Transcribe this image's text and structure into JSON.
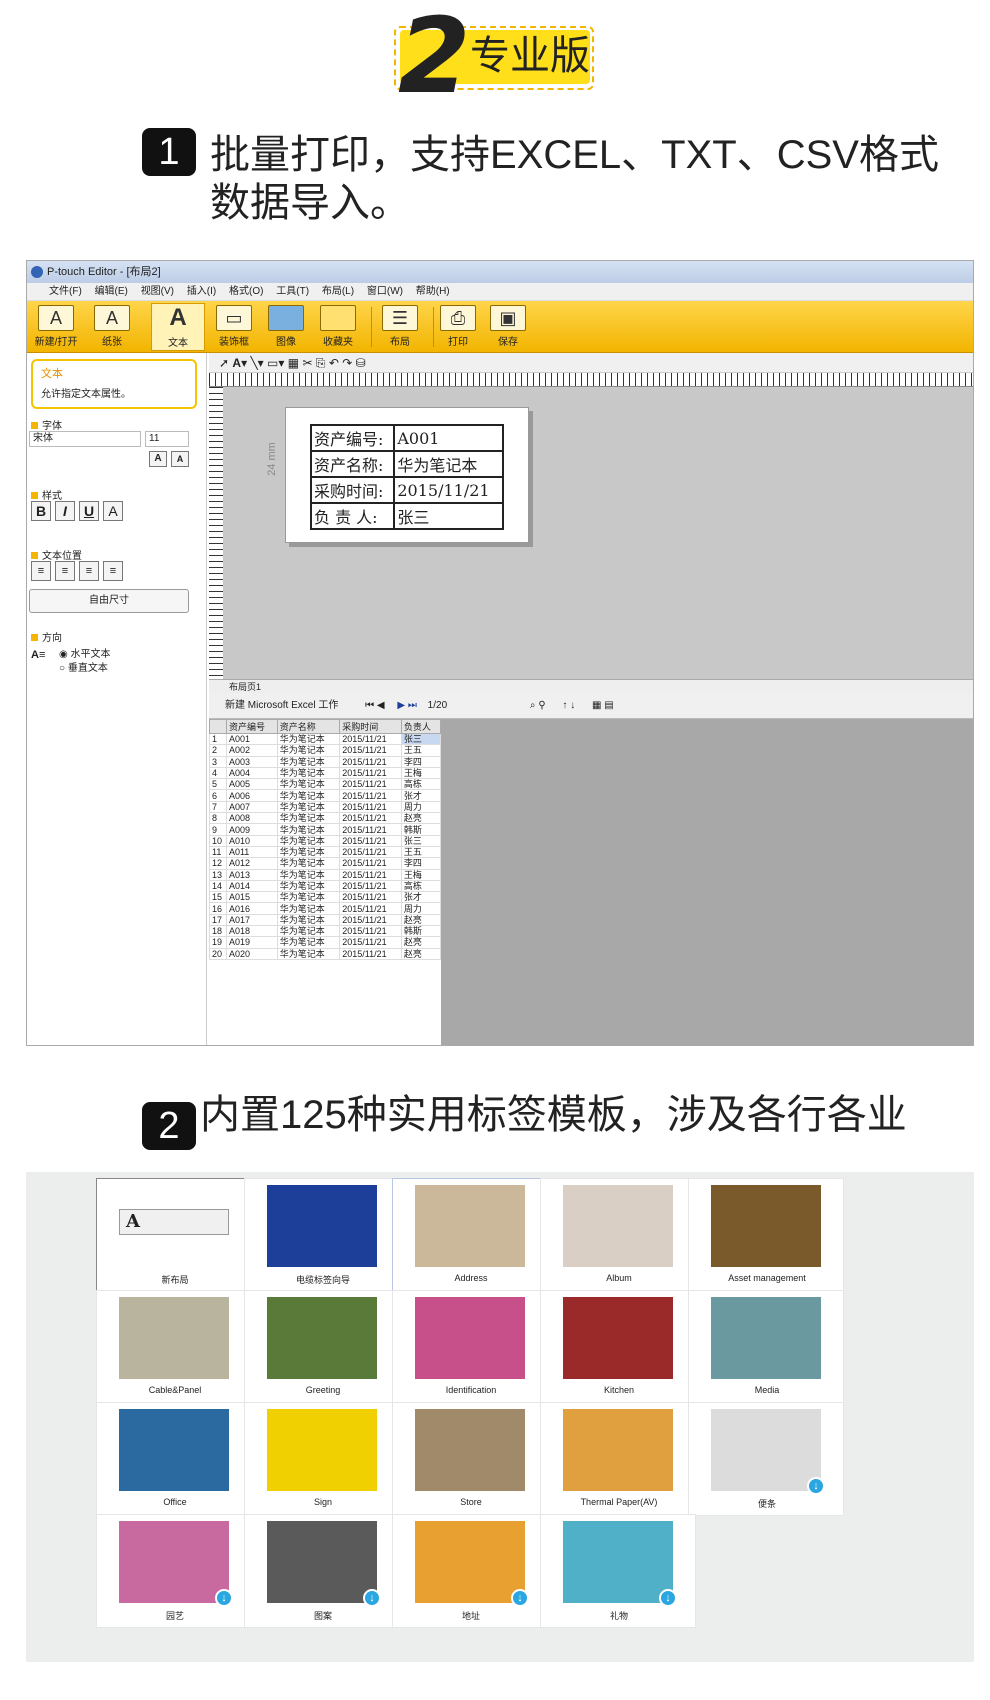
{
  "badge": {
    "number": "2",
    "text": "专业版"
  },
  "section1": {
    "number": "1",
    "line1": "批量打印，支持EXCEL、TXT、CSV格式",
    "line2": "数据导入。"
  },
  "section2": {
    "number": "2",
    "text": "内置125种实用标签模板，涉及各行各业"
  },
  "app": {
    "title": "P-touch Editor - [布局2]",
    "menu": [
      "文件(F)",
      "编辑(E)",
      "视图(V)",
      "插入(I)",
      "格式(O)",
      "工具(T)",
      "布局(L)",
      "窗口(W)",
      "帮助(H)"
    ],
    "ribbon": [
      "新建/打开",
      "纸张",
      "文本",
      "装饰框",
      "图像",
      "收藏夹",
      "布局",
      "打印",
      "保存"
    ],
    "panel": {
      "title": "文本",
      "desc": "允许指定文本属性。",
      "font_section": "字体",
      "font_name": "宋体",
      "font_size": "11",
      "style_section": "样式",
      "pos_section": "文本位置",
      "autosize": "自由尺寸",
      "dir_section": "方向",
      "dir_h": "水平文本",
      "dir_v": "垂直文本"
    },
    "canvas": {
      "mm": "24 mm",
      "tab": "布局页1",
      "label_rows": [
        [
          "资产编号:",
          "A001"
        ],
        [
          "资产名称:",
          "华为笔记本"
        ],
        [
          "采购时间:",
          "2015/11/21"
        ],
        [
          "负 责 人:",
          "张三"
        ]
      ]
    },
    "db": {
      "toolbar": "新建 Microsoft Excel 工作",
      "page": "1/20",
      "headers": [
        "",
        "资产编号",
        "资产名称",
        "采购时间",
        "负责人"
      ],
      "rows": [
        [
          "1",
          "A001",
          "华为笔记本",
          "2015/11/21",
          "张三"
        ],
        [
          "2",
          "A002",
          "华为笔记本",
          "2015/11/21",
          "王五"
        ],
        [
          "3",
          "A003",
          "华为笔记本",
          "2015/11/21",
          "李四"
        ],
        [
          "4",
          "A004",
          "华为笔记本",
          "2015/11/21",
          "王梅"
        ],
        [
          "5",
          "A005",
          "华为笔记本",
          "2015/11/21",
          "高栋"
        ],
        [
          "6",
          "A006",
          "华为笔记本",
          "2015/11/21",
          "张才"
        ],
        [
          "7",
          "A007",
          "华为笔记本",
          "2015/11/21",
          "周力"
        ],
        [
          "8",
          "A008",
          "华为笔记本",
          "2015/11/21",
          "赵亮"
        ],
        [
          "9",
          "A009",
          "华为笔记本",
          "2015/11/21",
          "韩斯"
        ],
        [
          "10",
          "A010",
          "华为笔记本",
          "2015/11/21",
          "张三"
        ],
        [
          "11",
          "A011",
          "华为笔记本",
          "2015/11/21",
          "王五"
        ],
        [
          "12",
          "A012",
          "华为笔记本",
          "2015/11/21",
          "李四"
        ],
        [
          "13",
          "A013",
          "华为笔记本",
          "2015/11/21",
          "王梅"
        ],
        [
          "14",
          "A014",
          "华为笔记本",
          "2015/11/21",
          "高栋"
        ],
        [
          "15",
          "A015",
          "华为笔记本",
          "2015/11/21",
          "张才"
        ],
        [
          "16",
          "A016",
          "华为笔记本",
          "2015/11/21",
          "周力"
        ],
        [
          "17",
          "A017",
          "华为笔记本",
          "2015/11/21",
          "赵亮"
        ],
        [
          "18",
          "A018",
          "华为笔记本",
          "2015/11/21",
          "韩斯"
        ],
        [
          "19",
          "A019",
          "华为笔记本",
          "2015/11/21",
          "赵亮"
        ],
        [
          "20",
          "A020",
          "华为笔记本",
          "2015/11/21",
          "赵亮"
        ]
      ]
    }
  },
  "templates": [
    {
      "label": "新布局",
      "color": "#f0f0f0"
    },
    {
      "label": "电缆标签向导",
      "color": "#1d3f9a"
    },
    {
      "label": "Address",
      "color": "#cbb79a"
    },
    {
      "label": "Album",
      "color": "#d9cfc4"
    },
    {
      "label": "Asset management",
      "color": "#7a5a2a"
    },
    {
      "label": "Cable&Panel",
      "color": "#b8b49e"
    },
    {
      "label": "Greeting",
      "color": "#5a7a3a"
    },
    {
      "label": "Identification",
      "color": "#c8508a"
    },
    {
      "label": "Kitchen",
      "color": "#9a2a2a"
    },
    {
      "label": "Media",
      "color": "#6a9aa0"
    },
    {
      "label": "Office",
      "color": "#2a6aa0"
    },
    {
      "label": "Sign",
      "color": "#f0d000"
    },
    {
      "label": "Store",
      "color": "#a08a6a"
    },
    {
      "label": "Thermal Paper(AV)",
      "color": "#e0a040"
    },
    {
      "label": "便条",
      "color": "#dcdcdc"
    },
    {
      "label": "园艺",
      "color": "#c86aa0"
    },
    {
      "label": "图案",
      "color": "#5a5a5a"
    },
    {
      "label": "地址",
      "color": "#e8a030"
    },
    {
      "label": "礼物",
      "color": "#50b0c8"
    }
  ]
}
